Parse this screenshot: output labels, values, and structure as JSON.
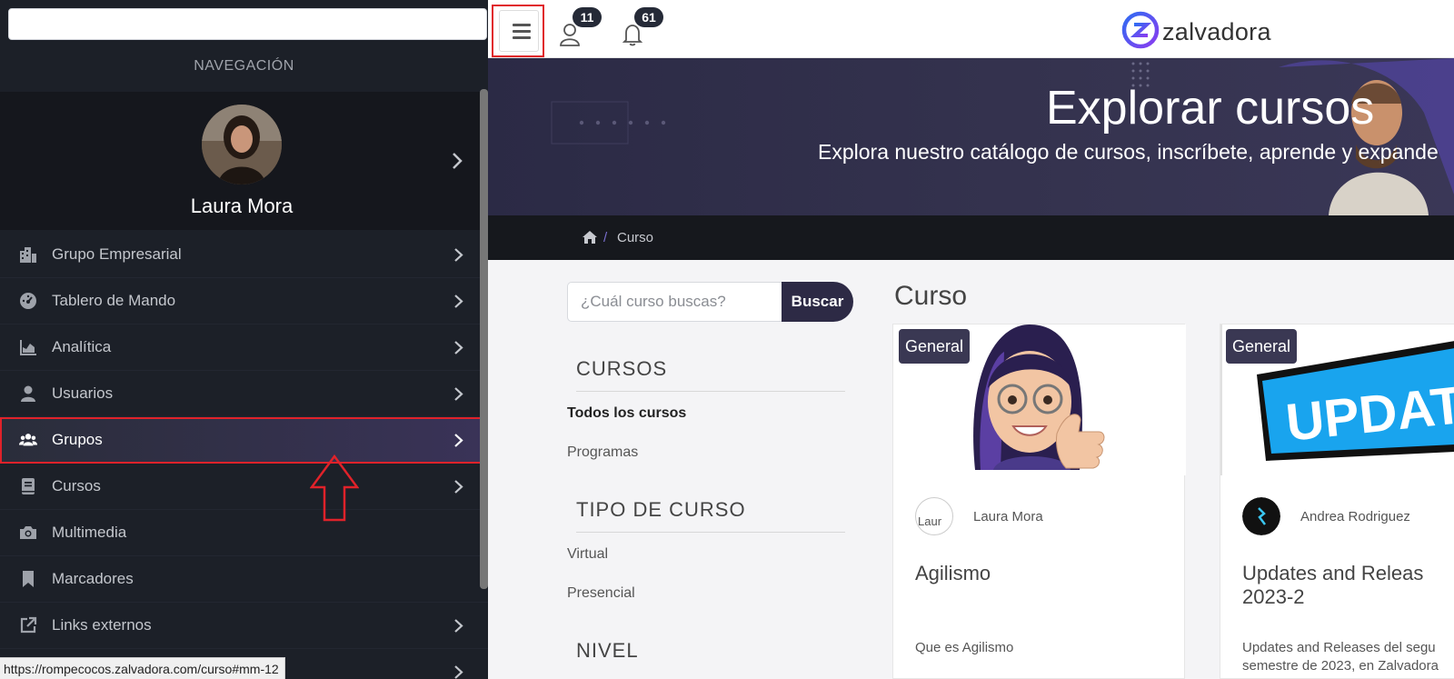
{
  "sidebar": {
    "nav_title": "NAVEGACIÓN",
    "user_name": "Laura Mora",
    "items": [
      {
        "label": "Grupo Empresarial",
        "icon": "building-icon",
        "chevron": true
      },
      {
        "label": "Tablero de Mando",
        "icon": "dashboard-icon",
        "chevron": true
      },
      {
        "label": "Analítica",
        "icon": "chart-area-icon",
        "chevron": true
      },
      {
        "label": "Usuarios",
        "icon": "user-icon",
        "chevron": true
      },
      {
        "label": "Grupos",
        "icon": "users-icon",
        "chevron": true,
        "active": true
      },
      {
        "label": "Cursos",
        "icon": "book-icon",
        "chevron": true
      },
      {
        "label": "Multimedia",
        "icon": "camera-icon",
        "chevron": false
      },
      {
        "label": "Marcadores",
        "icon": "bookmark-icon",
        "chevron": false
      },
      {
        "label": "Links externos",
        "icon": "external-link-icon",
        "chevron": true
      }
    ]
  },
  "status_bar": {
    "url": "https://rompecocos.zalvadora.com/curso#mm-12"
  },
  "topbar": {
    "users_badge": "11",
    "notifications_badge": "61",
    "logo_text": "zalvadora"
  },
  "hero": {
    "title": "Explorar cursos",
    "subtitle": "Explora nuestro catálogo de cursos, inscríbete, aprende y expande"
  },
  "breadcrumb": {
    "current": "Curso"
  },
  "search": {
    "placeholder": "¿Cuál curso buscas?",
    "button": "Buscar"
  },
  "filters": {
    "cursos_heading": "CURSOS",
    "cursos_links": [
      "Todos los cursos",
      "Programas"
    ],
    "tipo_heading": "TIPO DE CURSO",
    "tipo_links": [
      "Virtual",
      "Presencial"
    ],
    "nivel_heading": "NIVEL"
  },
  "main": {
    "title": "Curso"
  },
  "cards": [
    {
      "badge": "General",
      "author": "Laura Mora",
      "author_alt": "Laur",
      "title": "Agilismo",
      "description": "Que es Agilismo"
    },
    {
      "badge": "General",
      "author": "Andrea Rodriguez",
      "title_line1": "Updates and Releas",
      "title_line2": "2023-2",
      "desc_line1": "Updates and Releases del segu",
      "desc_line2": "semestre de 2023, en Zalvadora",
      "image_text": "UPDATE"
    }
  ],
  "colors": {
    "accent": "#2d2a45",
    "highlight": "#e0222a",
    "sidebar_bg": "#1c2028"
  }
}
